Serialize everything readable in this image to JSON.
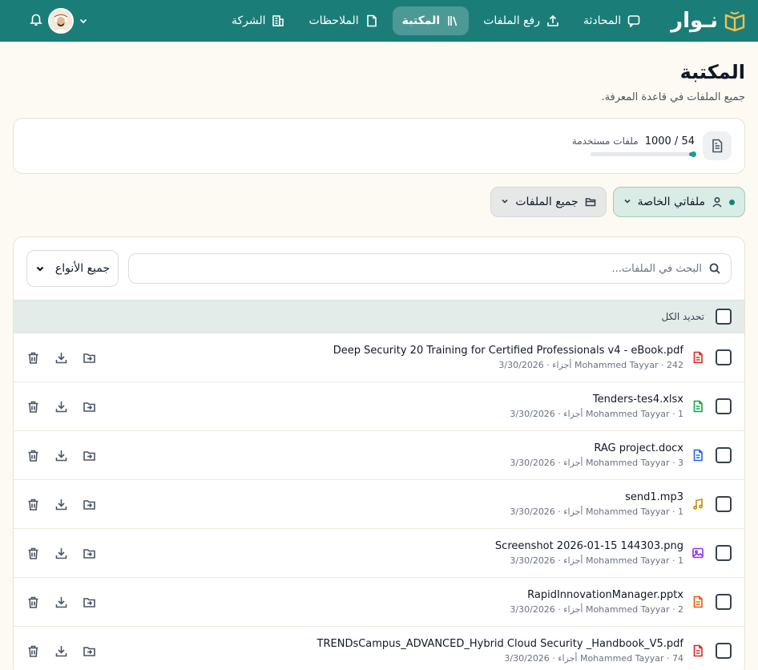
{
  "brand": {
    "name": "نـوار"
  },
  "nav": {
    "items": [
      {
        "label": "المحادثة",
        "icon": "chat-icon"
      },
      {
        "label": "رفع الملفات",
        "icon": "upload-icon"
      },
      {
        "label": "المكتبة",
        "icon": "library-icon",
        "active": true
      },
      {
        "label": "الملاحظات",
        "icon": "note-icon"
      },
      {
        "label": "الشركة",
        "icon": "building-icon"
      }
    ]
  },
  "page": {
    "title": "المكتبة",
    "subtitle": "جميع الملفات في قاعدة المعرفة."
  },
  "usage": {
    "count": "1000 / 54",
    "label": "ملفات مستخدمة",
    "fraction": 0.054
  },
  "filters": {
    "mine": "ملفاتي الخاصة",
    "all": "جميع الملفات"
  },
  "search": {
    "placeholder": "البحث في الملفات...",
    "type_select": "جميع الأنواع"
  },
  "select_all": "تحديد الكل",
  "files": [
    {
      "name": "Deep Security 20 Training for Certified Professionals v4 - eBook.pdf",
      "meta": "242 · Mohammed Tayyar أجزاء · 3/30/2026",
      "type": "pdf"
    },
    {
      "name": "Tenders-tes4.xlsx",
      "meta": "1 · Mohammed Tayyar أجزاء · 3/30/2026",
      "type": "xlsx"
    },
    {
      "name": "RAG project.docx",
      "meta": "3 · Mohammed Tayyar أجزاء · 3/30/2026",
      "type": "docx"
    },
    {
      "name": "send1.mp3",
      "meta": "1 · Mohammed Tayyar أجزاء · 3/30/2026",
      "type": "mp3"
    },
    {
      "name": "Screenshot 2026-01-15 144303.png",
      "meta": "1 · Mohammed Tayyar أجزاء · 3/30/2026",
      "type": "png"
    },
    {
      "name": "RapidInnovationManager.pptx",
      "meta": "2 · Mohammed Tayyar أجزاء · 3/30/2026",
      "type": "pptx"
    },
    {
      "name": "TRENDsCampus_ADVANCED_Hybrid Cloud Security _Handbook_V5.pdf",
      "meta": "74 · Mohammed Tayyar أجزاء · 3/30/2026",
      "type": "pdf"
    }
  ],
  "colors": {
    "nav_bg": "#1b7d78",
    "accent": "#1b9c8f",
    "pdf": "#dc2626",
    "xlsx": "#16a34a",
    "docx": "#2563eb",
    "mp3": "#ca8a04",
    "png": "#9333ea",
    "pptx": "#ea580c"
  }
}
